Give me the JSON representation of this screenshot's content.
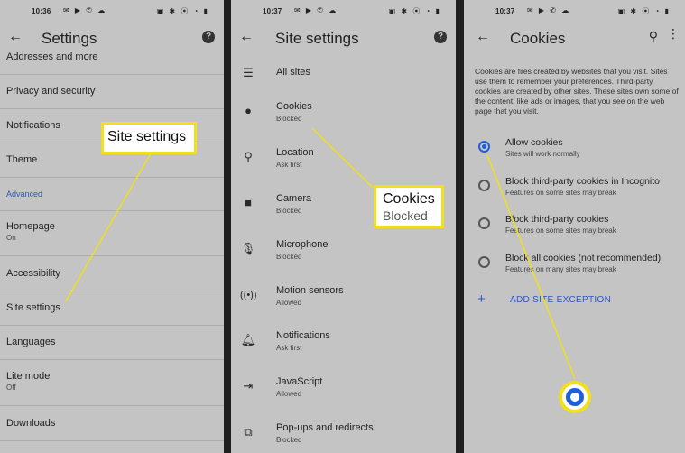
{
  "panel1": {
    "status_time": "10:36",
    "title": "Settings",
    "rows": [
      {
        "label": "Addresses and more",
        "sub": ""
      },
      {
        "label": "Privacy and security",
        "sub": ""
      },
      {
        "label": "Notifications",
        "sub": ""
      },
      {
        "label": "Theme",
        "sub": ""
      },
      {
        "label": "Homepage",
        "sub": "On"
      },
      {
        "label": "Accessibility",
        "sub": ""
      },
      {
        "label": "Site settings",
        "sub": ""
      },
      {
        "label": "Languages",
        "sub": ""
      },
      {
        "label": "Lite mode",
        "sub": "Off"
      },
      {
        "label": "Downloads",
        "sub": ""
      }
    ],
    "section_advanced": "Advanced",
    "callout": "Site settings"
  },
  "panel2": {
    "status_time": "10:37",
    "title": "Site settings",
    "rows": [
      {
        "label": "All sites",
        "status": "",
        "icon": "list-icon"
      },
      {
        "label": "Cookies",
        "status": "Blocked",
        "icon": "cookie-icon"
      },
      {
        "label": "Location",
        "status": "Ask first",
        "icon": "location-icon"
      },
      {
        "label": "Camera",
        "status": "Blocked",
        "icon": "camera-icon"
      },
      {
        "label": "Microphone",
        "status": "Blocked",
        "icon": "microphone-icon"
      },
      {
        "label": "Motion sensors",
        "status": "Allowed",
        "icon": "motion-sensor-icon"
      },
      {
        "label": "Notifications",
        "status": "Ask first",
        "icon": "bell-icon"
      },
      {
        "label": "JavaScript",
        "status": "Allowed",
        "icon": "javascript-icon"
      },
      {
        "label": "Pop-ups and redirects",
        "status": "Blocked",
        "icon": "external-link-icon"
      }
    ],
    "callout_title": "Cookies",
    "callout_sub": "Blocked"
  },
  "panel3": {
    "status_time": "10:37",
    "title": "Cookies",
    "description": "Cookies are files created by websites that you visit. Sites use them to remember your preferences. Third-party cookies are created by other sites. These sites own some of the content, like ads or images, that you see on the web page that you visit.",
    "options": [
      {
        "label": "Allow cookies",
        "sub": "Sites will work normally",
        "selected": true
      },
      {
        "label": "Block third-party cookies in Incognito",
        "sub": "Features on some sites may break",
        "selected": false
      },
      {
        "label": "Block third-party cookies",
        "sub": "Features on some sites may break",
        "selected": false
      },
      {
        "label": "Block all cookies (not recommended)",
        "sub": "Features on many sites may break",
        "selected": false
      }
    ],
    "add_exception": "ADD SITE EXCEPTION"
  },
  "colors": {
    "accent": "#2b57c7",
    "callout_border": "#f2e01a",
    "panel_bg": "#c4c4c4"
  }
}
